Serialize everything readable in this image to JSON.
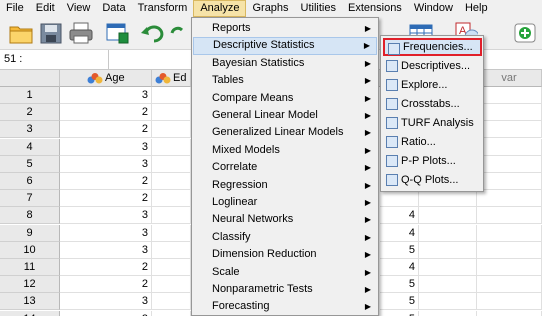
{
  "menubar": [
    "File",
    "Edit",
    "View",
    "Data",
    "Transform",
    "Analyze",
    "Graphs",
    "Utilities",
    "Extensions",
    "Window",
    "Help"
  ],
  "cell_ref": "51 :",
  "columns": {
    "age": "Age",
    "ed": "Ed",
    "var": "var"
  },
  "rows": [
    {
      "n": "1",
      "age": "3",
      "r": ""
    },
    {
      "n": "2",
      "age": "2",
      "r": ""
    },
    {
      "n": "3",
      "age": "2",
      "r": ""
    },
    {
      "n": "4",
      "age": "3",
      "r": ""
    },
    {
      "n": "5",
      "age": "3",
      "r": ""
    },
    {
      "n": "6",
      "age": "2",
      "r": ""
    },
    {
      "n": "7",
      "age": "2",
      "r": ""
    },
    {
      "n": "8",
      "age": "3",
      "r": "4"
    },
    {
      "n": "9",
      "age": "3",
      "r": "4"
    },
    {
      "n": "10",
      "age": "3",
      "r": "5"
    },
    {
      "n": "11",
      "age": "2",
      "r": "4"
    },
    {
      "n": "12",
      "age": "2",
      "r": "5"
    },
    {
      "n": "13",
      "age": "3",
      "r": "5"
    },
    {
      "n": "14",
      "age": "3",
      "r": "5"
    }
  ],
  "analyze_menu": [
    {
      "label": "Reports",
      "arrow": "▶"
    },
    {
      "label": "Descriptive Statistics",
      "arrow": "▶"
    },
    {
      "label": "Bayesian Statistics",
      "arrow": "▶"
    },
    {
      "label": "Tables",
      "arrow": "▶"
    },
    {
      "label": "Compare Means",
      "arrow": "▶"
    },
    {
      "label": "General Linear Model",
      "arrow": "▶"
    },
    {
      "label": "Generalized Linear Models",
      "arrow": "▶"
    },
    {
      "label": "Mixed Models",
      "arrow": "▶"
    },
    {
      "label": "Correlate",
      "arrow": "▶"
    },
    {
      "label": "Regression",
      "arrow": "▶"
    },
    {
      "label": "Loglinear",
      "arrow": "▶"
    },
    {
      "label": "Neural Networks",
      "arrow": "▶"
    },
    {
      "label": "Classify",
      "arrow": "▶"
    },
    {
      "label": "Dimension Reduction",
      "arrow": "▶"
    },
    {
      "label": "Scale",
      "arrow": "▶"
    },
    {
      "label": "Nonparametric Tests",
      "arrow": "▶"
    },
    {
      "label": "Forecasting",
      "arrow": "▶"
    }
  ],
  "descriptive_submenu": [
    "Frequencies...",
    "Descriptives...",
    "Explore...",
    "Crosstabs...",
    "TURF Analysis",
    "Ratio...",
    "P-P Plots...",
    "Q-Q Plots..."
  ],
  "colors": {
    "menu_active": "#f6e3a8",
    "highlight": "#d6e5f5",
    "selection_border": "#e0202a"
  }
}
